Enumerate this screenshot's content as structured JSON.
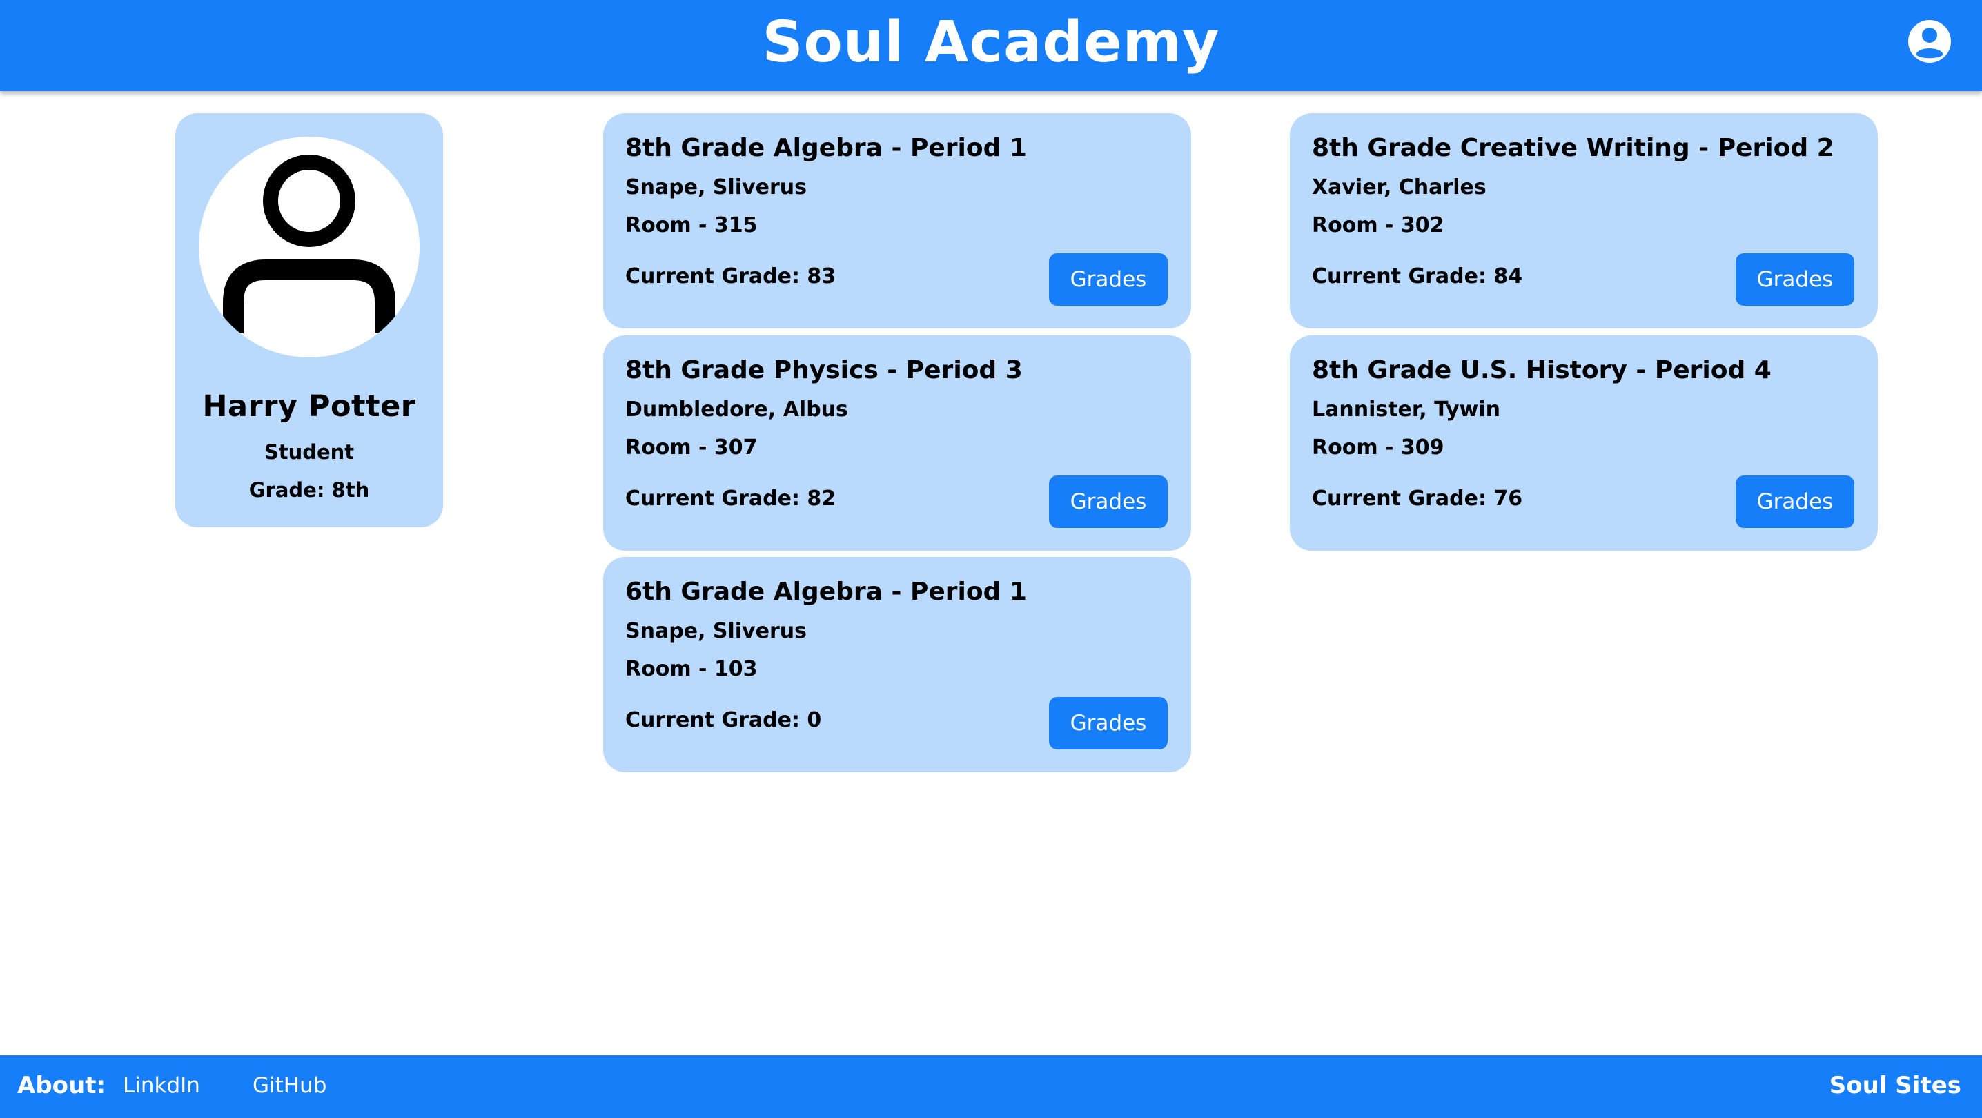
{
  "header": {
    "title": "Soul Academy",
    "account_icon": "account-circle-icon"
  },
  "profile": {
    "avatar_icon": "user-icon",
    "name": "Harry Potter",
    "role": "Student",
    "grade_level": "Grade: 8th"
  },
  "courses": [
    {
      "title": "8th Grade Algebra - Period 1",
      "teacher": "Snape, Sliverus",
      "room": "Room - 315",
      "current_grade": "Current Grade: 83",
      "button_label": "Grades"
    },
    {
      "title": "8th Grade Creative Writing - Period 2",
      "teacher": "Xavier, Charles",
      "room": "Room - 302",
      "current_grade": "Current Grade: 84",
      "button_label": "Grades"
    },
    {
      "title": "8th Grade Physics - Period 3",
      "teacher": "Dumbledore, Albus",
      "room": "Room - 307",
      "current_grade": "Current Grade: 82",
      "button_label": "Grades"
    },
    {
      "title": "8th Grade U.S. History - Period 4",
      "teacher": "Lannister, Tywin",
      "room": "Room - 309",
      "current_grade": "Current Grade: 76",
      "button_label": "Grades"
    },
    {
      "title": "6th Grade Algebra - Period 1",
      "teacher": "Snape, Sliverus",
      "room": "Room - 103",
      "current_grade": "Current Grade: 0",
      "button_label": "Grades"
    }
  ],
  "footer": {
    "about_label": "About:",
    "links": [
      "LinkdIn",
      "GitHub"
    ],
    "brand": "Soul Sites"
  },
  "colors": {
    "primary": "#167ef8",
    "card_background": "#b9d9fd",
    "page_background": "#ffffff",
    "text": "#000000"
  }
}
